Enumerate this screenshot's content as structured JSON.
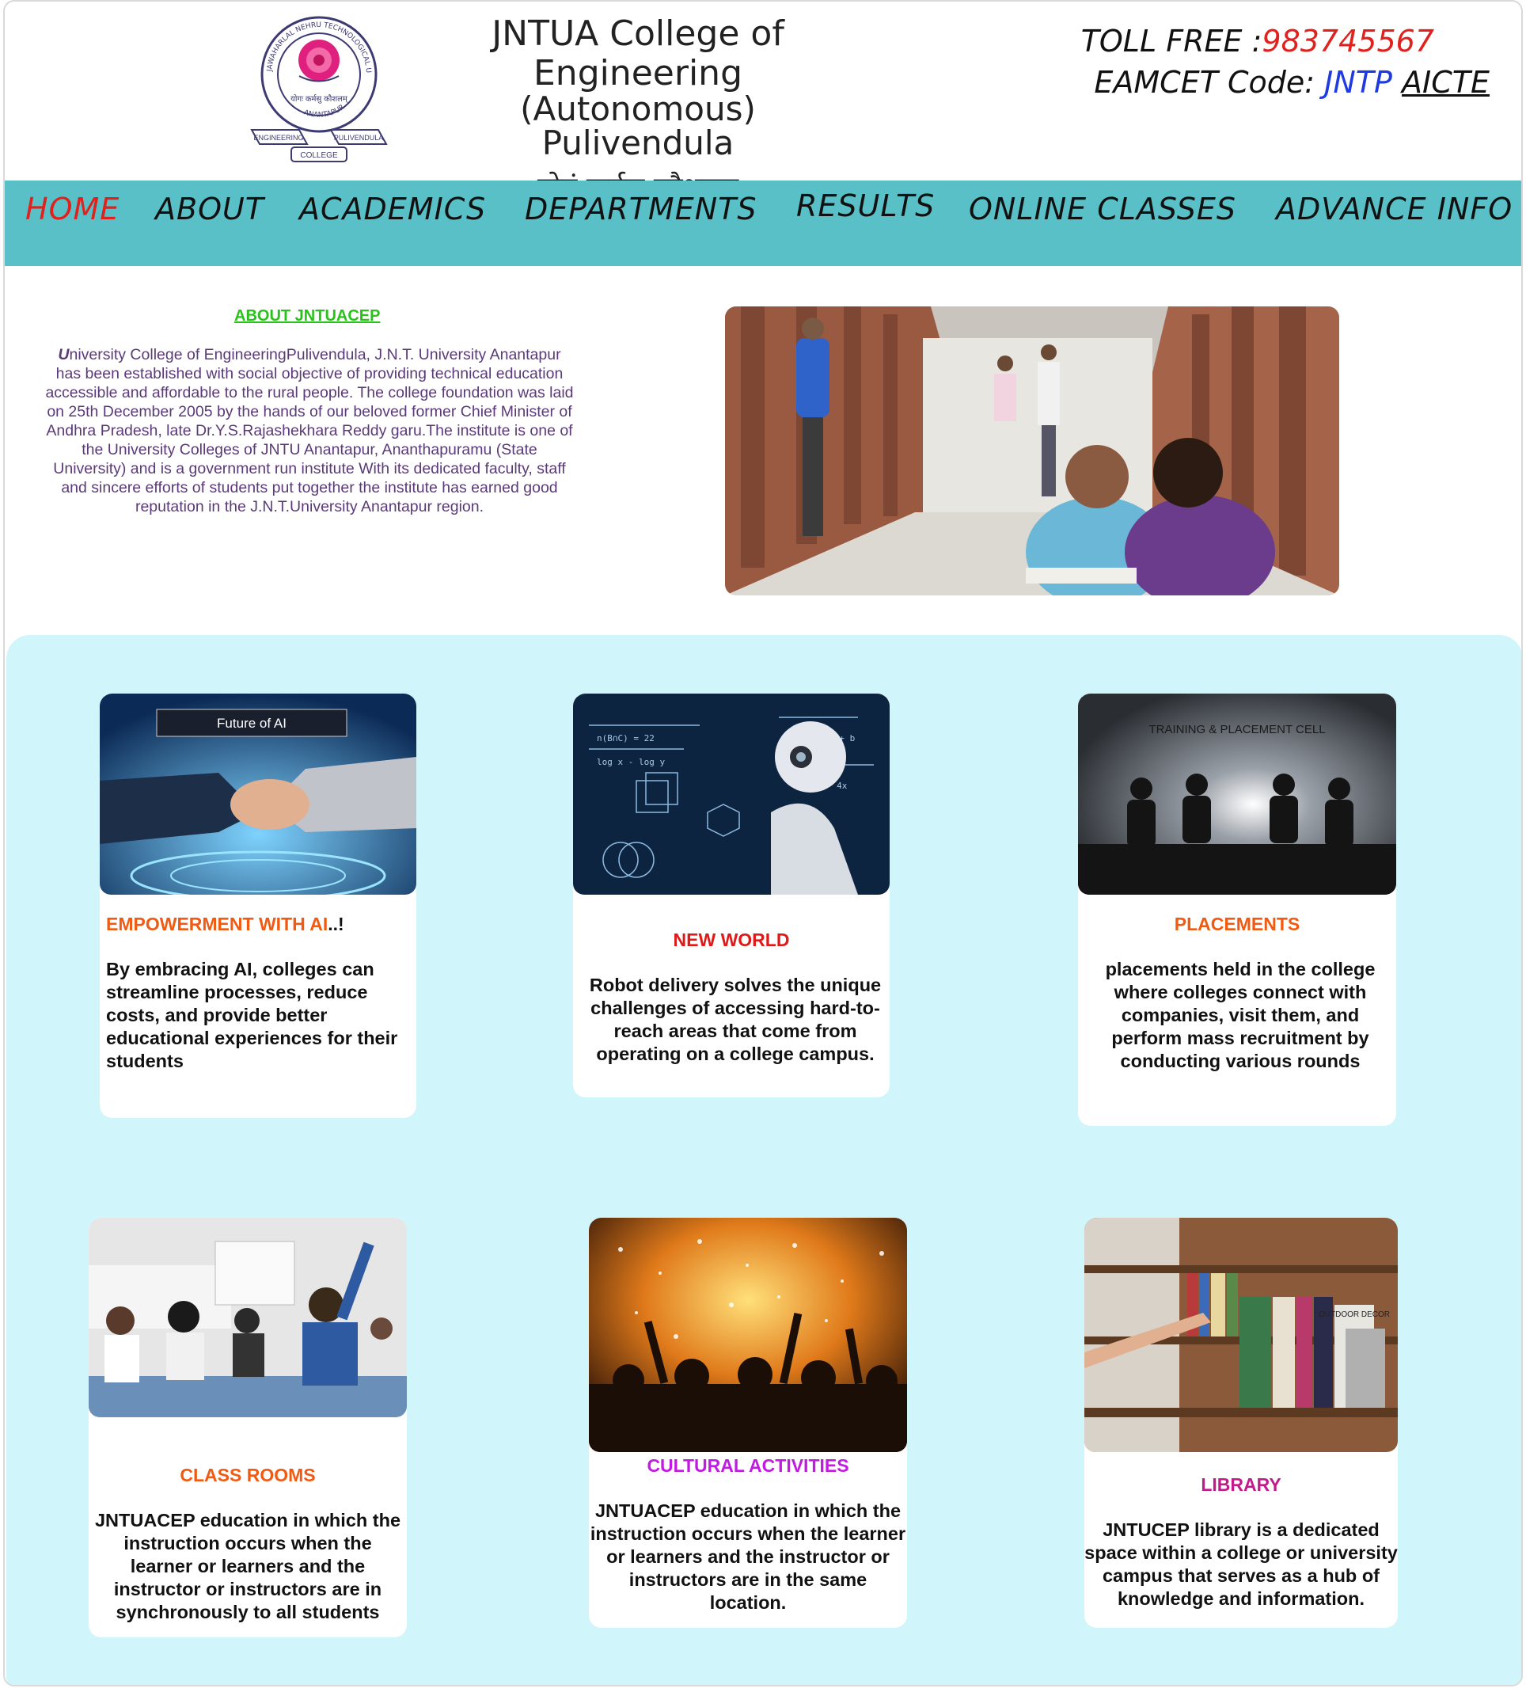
{
  "header": {
    "college_line1": "JNTUA College of Engineering",
    "college_line2": "(Autonomous)",
    "college_line3": "Pulivendula",
    "motto": "योगं कर्मसु कौशलम्",
    "logo": {
      "ring_top": "JAWAHARLAL NEHRU TECHNOLOGICAL UNIVERSITY",
      "ring_bottom": "ANANTAPUR",
      "motto": "योगः कर्मसु कौशलम्",
      "ribbon_left": "ENGINEERING",
      "ribbon_right": "PULIVENDULA",
      "ribbon_bottom": "COLLEGE"
    },
    "toll_free_label": "TOLL FREE :",
    "toll_free_number": "983745567",
    "eamcet_label": "EAMCET Code: ",
    "eamcet_code": "JNTP",
    "aicte_link": "AICTE"
  },
  "nav": {
    "items": [
      {
        "label": "HOME",
        "active": true
      },
      {
        "label": "ABOUT"
      },
      {
        "label": "ACADEMICS"
      },
      {
        "label": "DEPARTMENTS"
      },
      {
        "label": "RESULTS"
      },
      {
        "label": "ONLINE CLASSES"
      },
      {
        "label": "ADVANCE INFO"
      }
    ]
  },
  "about": {
    "title": "ABOUT JNTUACEP",
    "first_letter": "U",
    "text_rest": "niversity College of EngineeringPulivendula, J.N.T. University Anantapur has been established with social objective of providing technical education accessible and affordable to the rural people. The college foundation was laid on 25th December 2005 by the hands of our beloved former Chief Minister of Andhra Pradesh, late Dr.Y.S.Rajashekhara Reddy garu.The institute is one of the University Colleges of JNTU Anantapur, Ananthapuramu (State University) and is a government run institute With its dedicated faculty, staff and sincere efforts of students put together the institute has earned good reputation in the J.N.T.University Anantapur region."
  },
  "cards": [
    {
      "title": "EMPOWERMENT WITH AI",
      "title_suffix": "..!",
      "image_caption": "Future of AI",
      "text": "By embracing AI, colleges can streamline processes, reduce costs, and provide better educational experiences for their students",
      "title_color": "#f05a12"
    },
    {
      "title": "NEW WORLD",
      "text": "Robot delivery solves the unique challenges of accessing hard-to-reach areas that come from operating on a college campus.",
      "title_color": "#e01818"
    },
    {
      "title": "PLACEMENTS",
      "image_caption": "TRAINING & PLACEMENT CELL",
      "text": "placements held in the college where colleges connect with companies, visit them, and perform mass recruitment by conducting various rounds",
      "title_color": "#f05a12"
    },
    {
      "title": "CLASS ROOMS",
      "text": "JNTUACEP education in which the instruction occurs when the learner or learners and the instructor or instructors are in synchronously to all students",
      "title_color": "#f05a12"
    },
    {
      "title": "CULTURAL ACTIVITIES",
      "text": "JNTUACEP education in which the instruction occurs when the learner or learners and the instructor or instructors are in the same location.",
      "title_color": "#c21ae0"
    },
    {
      "title": "LIBRARY",
      "image_caption": "OUTDOOR DECOR",
      "text": "JNTUCEP library is a dedicated space within a college or university campus that serves as a hub of knowledge and information.",
      "title_color": "#c21a8c"
    }
  ]
}
